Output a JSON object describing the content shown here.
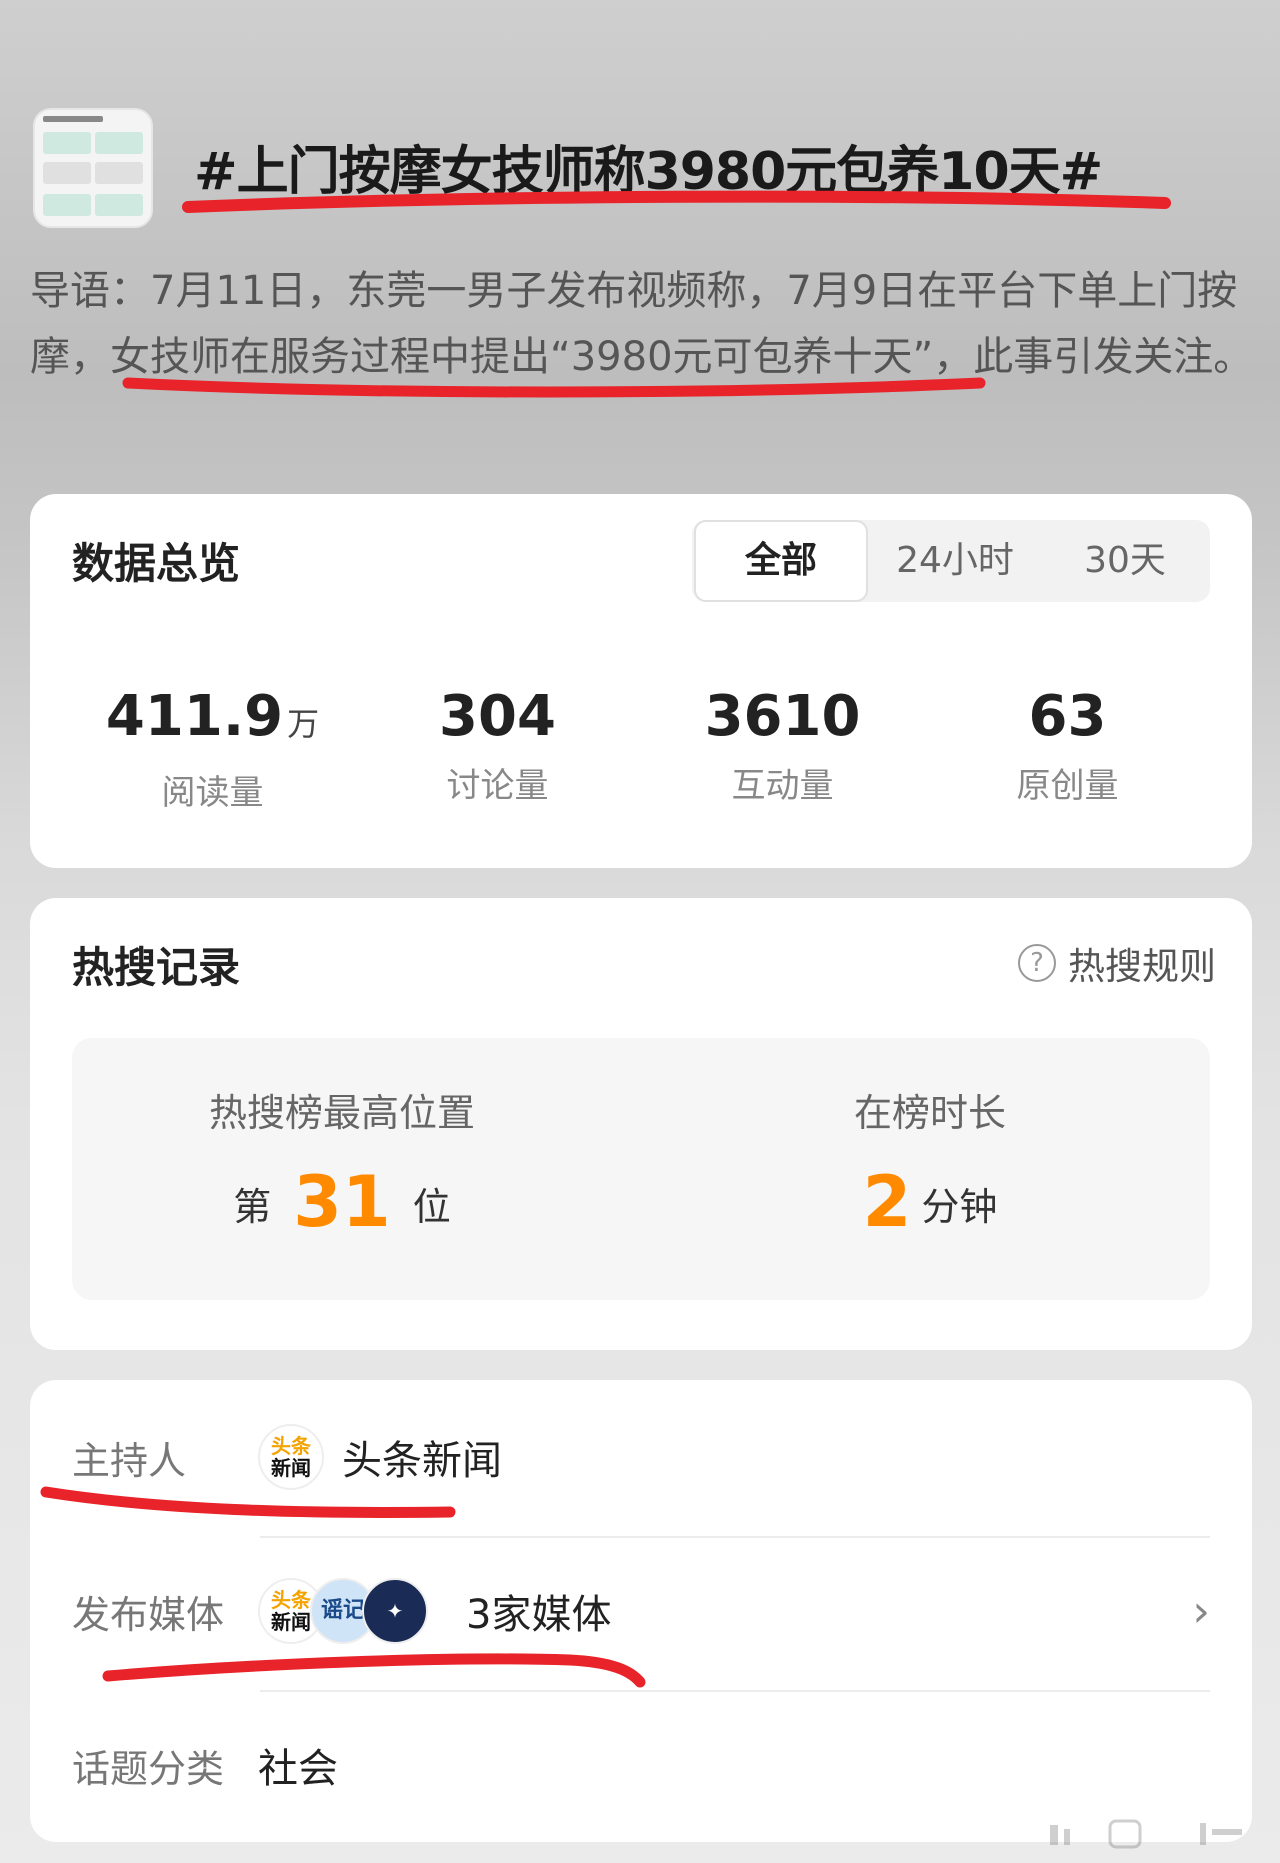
{
  "topic": {
    "title": "#上门按摩女技师称3980元包养10天#",
    "lead": "导语：7月11日，东莞一男子发布视频称，7月9日在平台下单上门按摩，女技师在服务过程中提出“3980元可包养十天”，此事引发关注。"
  },
  "overview": {
    "title": "数据总览",
    "tabs": [
      "全部",
      "24小时",
      "30天"
    ],
    "active_tab": "全部",
    "stats": [
      {
        "value": "411.9",
        "unit": "万",
        "label": "阅读量"
      },
      {
        "value": "304",
        "unit": "",
        "label": "讨论量"
      },
      {
        "value": "3610",
        "unit": "",
        "label": "互动量"
      },
      {
        "value": "63",
        "unit": "",
        "label": "原创量"
      }
    ]
  },
  "hot_search": {
    "title": "热搜记录",
    "rules_label": "热搜规则",
    "rules_icon": "?",
    "peak_caption": "热搜榜最高位置",
    "peak_prefix": "第",
    "peak_value": "31",
    "peak_suffix": "位",
    "duration_caption": "在榜时长",
    "duration_value": "2",
    "duration_unit": "分钟"
  },
  "meta": {
    "host_label": "主持人",
    "host_name": "头条新闻",
    "host_logo_top": "头条",
    "host_logo_bottom": "新闻",
    "media_label": "发布媒体",
    "media_count": "3家媒体",
    "media_logo2": "谣记",
    "category_label": "话题分类",
    "category_value": "社会"
  },
  "colors": {
    "accent": "#ff8a00",
    "underline": "#e8232a"
  }
}
